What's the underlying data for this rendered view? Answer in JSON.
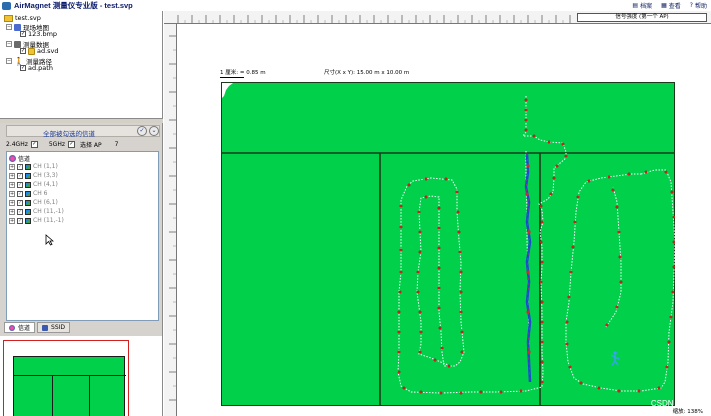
{
  "window": {
    "title": "AirMagnet 测量仪专业版 - test.svp",
    "menus": [
      "档案",
      "查看",
      "帮助"
    ]
  },
  "tree": {
    "root": "test.svp",
    "groups": [
      {
        "label": "现场地图",
        "child": "123.bmp"
      },
      {
        "label": "测量数据",
        "child": "ad.svd"
      },
      {
        "label": "测量路径",
        "child": "ad.path"
      }
    ]
  },
  "channel_panel": {
    "title": "全部被勾选的信道",
    "bands": {
      "b24": "2.4GHz",
      "b5": "5GHz",
      "ap": "选择 AP",
      "num": "7"
    },
    "list_header": "信道",
    "channels": [
      "CH (1,1)",
      "CH (3,3)",
      "CH (4,1)",
      "CH 6",
      "CH (6,1)",
      "CH (11,-1)",
      "CH (11,-1)"
    ],
    "tabs": [
      "信道",
      "SSID"
    ]
  },
  "map": {
    "signal_label": "信号强度 (第一个 AP)",
    "scale_text": "1 厘米: = 0.85 m",
    "size_text": "尺寸(X x Y): 15.00 m x 10.00 m",
    "zoom_text": "缩放: 138%",
    "watermark": "CSDN @lchen"
  },
  "colors": {
    "map_fill": "#00d04a",
    "path_red": "#e0201a",
    "path_blue": "#1a4ad0",
    "walls": "#1a3a1a"
  }
}
